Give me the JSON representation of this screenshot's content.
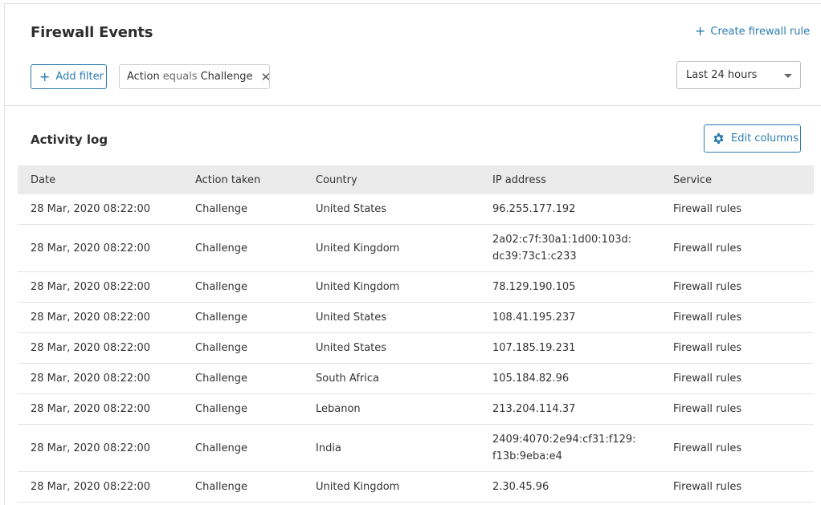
{
  "header": {
    "title": "Firewall Events",
    "create_rule": "Create firewall rule",
    "add_filter": "Add filter",
    "filter_chip": {
      "field": "Action",
      "operator": "equals",
      "value": "Challenge"
    },
    "time_range": "Last 24 hours"
  },
  "activity": {
    "title": "Activity log",
    "edit_columns": "Edit columns",
    "columns": [
      "Date",
      "Action taken",
      "Country",
      "IP address",
      "Service"
    ],
    "rows": [
      {
        "date": "28 Mar, 2020 08:22:00",
        "action": "Challenge",
        "country": "United States",
        "ip": "96.255.177.192",
        "service": "Firewall rules"
      },
      {
        "date": "28 Mar, 2020 08:22:00",
        "action": "Challenge",
        "country": "United Kingdom",
        "ip": "2a02:c7f:30a1:1d00:103d:dc39:73c1:c233",
        "service": "Firewall rules"
      },
      {
        "date": "28 Mar, 2020 08:22:00",
        "action": "Challenge",
        "country": "United Kingdom",
        "ip": "78.129.190.105",
        "service": "Firewall rules"
      },
      {
        "date": "28 Mar, 2020 08:22:00",
        "action": "Challenge",
        "country": "United States",
        "ip": "108.41.195.237",
        "service": "Firewall rules"
      },
      {
        "date": "28 Mar, 2020 08:22:00",
        "action": "Challenge",
        "country": "United States",
        "ip": "107.185.19.231",
        "service": "Firewall rules"
      },
      {
        "date": "28 Mar, 2020 08:22:00",
        "action": "Challenge",
        "country": "South Africa",
        "ip": "105.184.82.96",
        "service": "Firewall rules"
      },
      {
        "date": "28 Mar, 2020 08:22:00",
        "action": "Challenge",
        "country": "Lebanon",
        "ip": "213.204.114.37",
        "service": "Firewall rules"
      },
      {
        "date": "28 Mar, 2020 08:22:00",
        "action": "Challenge",
        "country": "India",
        "ip": "2409:4070:2e94:cf31:f129:f13b:9eba:e4",
        "service": "Firewall rules"
      },
      {
        "date": "28 Mar, 2020 08:22:00",
        "action": "Challenge",
        "country": "United Kingdom",
        "ip": "2.30.45.96",
        "service": "Firewall rules"
      }
    ]
  },
  "colors": {
    "accent": "#2c7cb0",
    "header_bg": "#ebebeb",
    "border": "#e2e2e2"
  },
  "icons": {
    "add": "plus-icon",
    "remove": "close-icon",
    "dropdown": "caret-down-icon",
    "settings": "gear-icon"
  }
}
